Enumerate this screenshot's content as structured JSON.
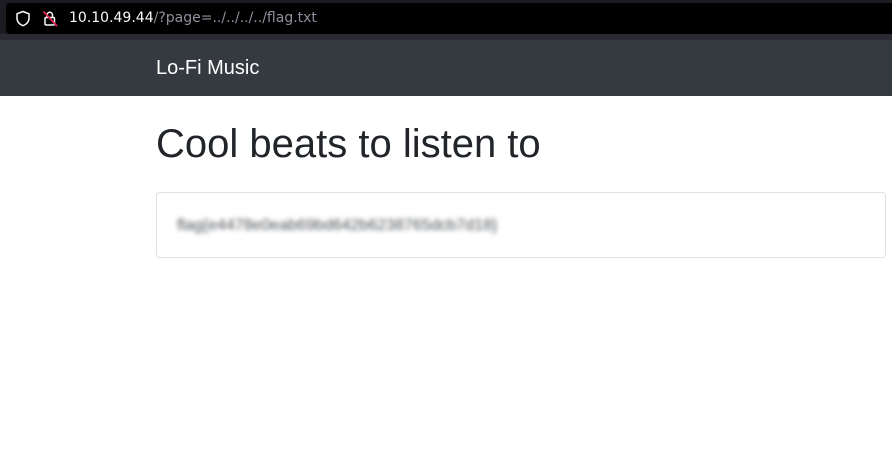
{
  "browser": {
    "url_host": "10.10.49.44",
    "url_path": "/?page=../../../../flag.txt",
    "icons": {
      "tracking_protection": "shield-icon",
      "insecure_connection": "lock-crossed-icon"
    },
    "colors": {
      "url_host": "#fbfbfe",
      "url_path": "#8f8f9d",
      "insecure_lock": "#e22850"
    }
  },
  "navbar": {
    "brand": "Lo-Fi Music",
    "background": "#343a40"
  },
  "main": {
    "title": "Cool beats to listen to",
    "card_text": "flag{e4478e0eab69bd642b6238765dcb7d18}"
  }
}
